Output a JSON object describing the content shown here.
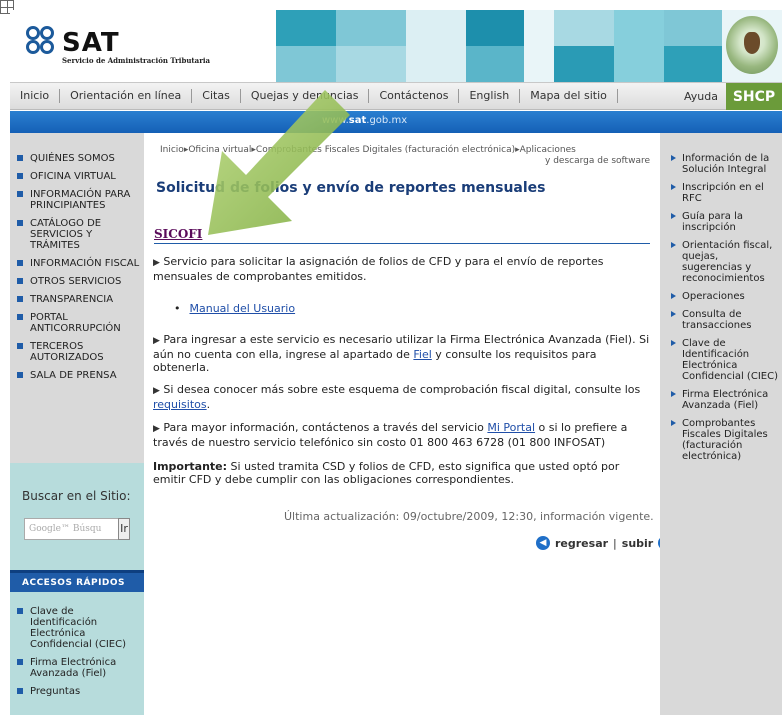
{
  "header": {
    "logo_text": "SAT",
    "logo_subtitle": "Servicio de Administración Tributaria",
    "mosaic_colors": [
      "#ffffff",
      "#7fc7d6",
      "#2ea0b8",
      "#dceff3",
      "#a8d9e3",
      "#1d8fac",
      "#5ab5c9",
      "#e9f5f8",
      "#2a9bb5",
      "#86cfdc"
    ]
  },
  "nav": {
    "items": [
      "Inicio",
      "Orientación en línea",
      "Citas",
      "Quejas y denuncias",
      "Contáctenos",
      "English",
      "Mapa del sitio"
    ],
    "ayuda": "Ayuda",
    "shcp": "SHCP"
  },
  "urlbar": {
    "prefix": "www.",
    "bold": "sat",
    "suffix": ".gob.mx"
  },
  "left_menu": [
    "Quiénes somos",
    "Oficina virtual",
    "Información para principiantes",
    "Catálogo de servicios y trámites",
    "Información fiscal",
    "Otros servicios",
    "Transparencia",
    "Portal anticorrupción",
    "Terceros autorizados",
    "Sala de prensa"
  ],
  "search": {
    "label": "Buscar en el Sitio:",
    "placeholder": "Google™ Búsqu",
    "button": "Ir"
  },
  "quick_access": {
    "title": "Accesos rápidos",
    "items": [
      "Clave de Identificación Electrónica Confidencial (CIEC)",
      "Firma Electrónica Avanzada (Fiel)",
      "Preguntas"
    ]
  },
  "main": {
    "breadcrumb_line1": "Inicio▸Oficina virtual▸Comprobantes Fiscales Digitales (facturación electrónica)▸Aplicaciones",
    "breadcrumb_line2": "y descarga de software",
    "title": "Solicitud de folios y envío de reportes mensuales",
    "section_title": "SICOFI",
    "p1": "Servicio para solicitar la asignación de folios de CFD y para el envío de reportes mensuales de comprobantes emitidos.",
    "manual_link": "Manual del Usuario",
    "p2_a": "Para ingresar a este servicio es necesario utilizar la Firma Electrónica Avanzada (Fiel). Si aún no cuenta con ella, ingrese al apartado de ",
    "p2_link": "Fiel",
    "p2_b": " y consulte los requisitos para obtenerla.",
    "p3_a": "Si desea conocer más sobre este esquema de comprobación fiscal digital, consulte los ",
    "p3_link": "requisitos",
    "p3_b": ".",
    "p4_a": "Para mayor información, contáctenos a través del servicio ",
    "p4_link": "Mi Portal",
    "p4_b": " o si lo prefiere a través de nuestro servicio telefónico sin costo 01 800 463 6728 (01 800 INFOSAT)",
    "important_label": "Importante:",
    "important_text": " Si usted tramita CSD y folios de CFD, esto significa que usted optó por emitir CFD y debe cumplir con las obligaciones correspondientes.",
    "updated": "Última actualización: 09/octubre/2009, 12:30, información vigente.",
    "back": "regresar",
    "separator": "|",
    "up": "subir"
  },
  "right_menu": [
    "Información de la Solución Integral",
    "Inscripción en el RFC",
    "Guía para la inscripción",
    "Orientación fiscal, quejas, sugerencias y reconocimientos",
    "Operaciones",
    "Consulta de transacciones",
    "Clave de Identificación Electrónica Confidencial (CIEC)",
    "Firma Electrónica Avanzada (Fiel)",
    "Comprobantes Fiscales Digitales (facturación electrónica)"
  ],
  "colors": {
    "nav_blue": "#1f5ca8",
    "shcp_green": "#6b9b3a",
    "arrow_green": "#8dbb4a",
    "link": "#1f4ea8",
    "sicofi": "#5a0b5a"
  }
}
